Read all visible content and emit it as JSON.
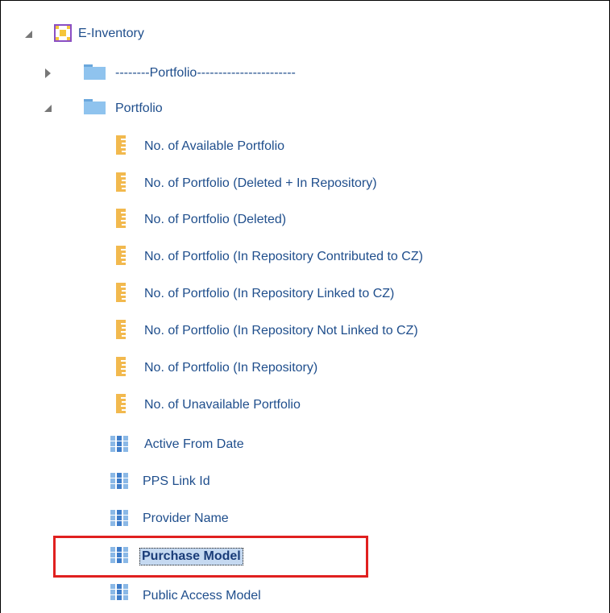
{
  "tree": {
    "root": {
      "label": "E-Inventory",
      "icon": "subject-area-icon",
      "expanded": true
    },
    "folders": [
      {
        "label": "--------Portfolio-----------------------",
        "icon": "folder-icon",
        "expanded": false
      },
      {
        "label": "Portfolio",
        "icon": "folder-icon",
        "expanded": true
      }
    ],
    "measures": [
      "No. of Available Portfolio",
      "No. of Portfolio (Deleted + In Repository)",
      "No. of Portfolio (Deleted)",
      "No. of Portfolio (In Repository Contributed to CZ)",
      "No. of Portfolio (In Repository Linked to CZ)",
      "No. of Portfolio (In Repository Not Linked to CZ)",
      "No. of Portfolio (In Repository)",
      "No. of Unavailable Portfolio"
    ],
    "attributes": [
      "Active From Date",
      "PPS Link Id",
      "Provider Name",
      "Purchase Model",
      "Public Access Model"
    ],
    "selected": "Purchase Model"
  },
  "colors": {
    "label": "#1f4e8c",
    "highlight_border": "#e0201f",
    "selection_bg": "#c5d9f1",
    "folder": "#8fc3ee",
    "measure": "#f2b94e",
    "attribute": "#3d7cc9"
  }
}
